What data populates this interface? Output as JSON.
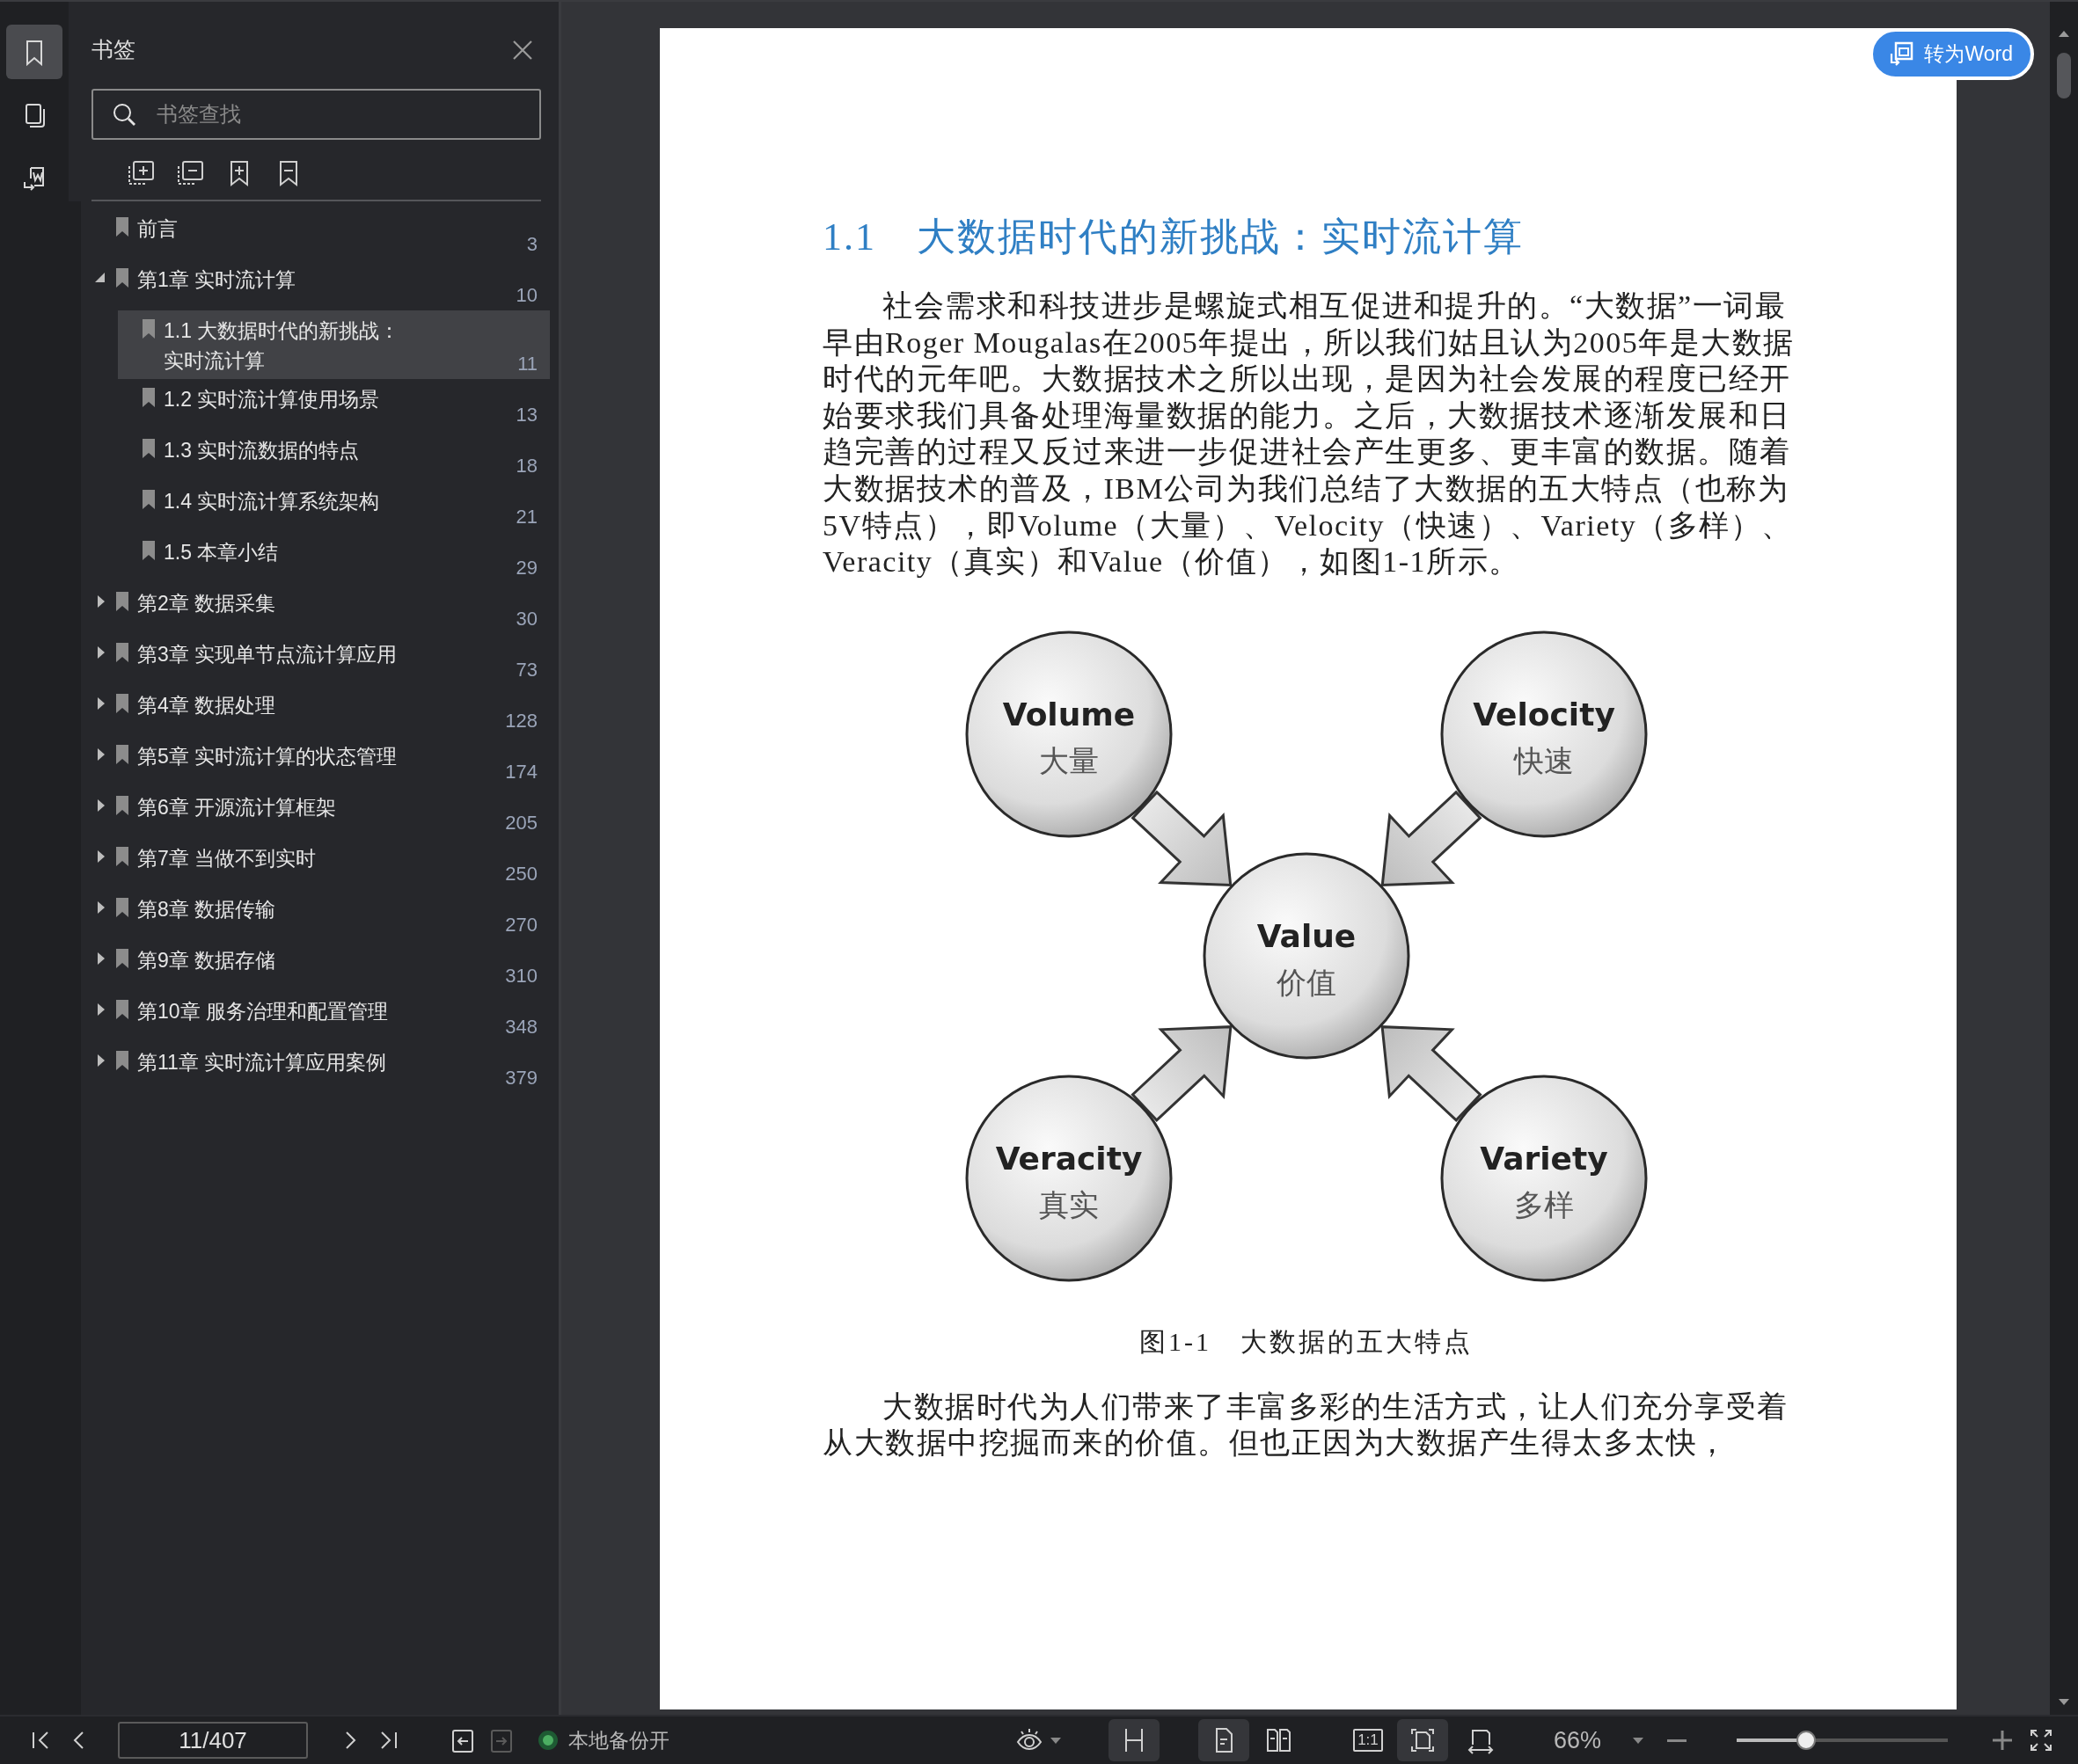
{
  "rail_tabs": [
    {
      "kind": "bookmarks",
      "selected": true
    },
    {
      "kind": "thumbnails",
      "selected": false
    },
    {
      "kind": "convert",
      "selected": false
    }
  ],
  "bookmark_panel": {
    "title": "书签",
    "search": {
      "placeholder": "书签查找"
    },
    "tree": [
      {
        "label": "前言",
        "page": "3",
        "selected": false
      },
      {
        "label": "第1章 实时流计算",
        "page": "10",
        "selected": false,
        "expanded": true,
        "children": [
          {
            "label": "1.1 大数据时代的新挑战：实时流计算",
            "page": "11",
            "selected": true
          },
          {
            "label": "1.2 实时流计算使用场景",
            "page": "13",
            "selected": false
          },
          {
            "label": "1.3 实时流数据的特点",
            "page": "18",
            "selected": false
          },
          {
            "label": "1.4 实时流计算系统架构",
            "page": "21",
            "selected": false
          },
          {
            "label": "1.5 本章小结",
            "page": "29",
            "selected": false
          }
        ]
      },
      {
        "label": "第2章 数据采集",
        "page": "30",
        "selected": false,
        "expanded": false
      },
      {
        "label": "第3章 实现单节点流计算应用",
        "page": "73",
        "selected": false,
        "expanded": false
      },
      {
        "label": "第4章 数据处理",
        "page": "128",
        "selected": false,
        "expanded": false
      },
      {
        "label": "第5章 实时流计算的状态管理",
        "page": "174",
        "selected": false,
        "expanded": false
      },
      {
        "label": "第6章 开源流计算框架",
        "page": "205",
        "selected": false,
        "expanded": false
      },
      {
        "label": "第7章 当做不到实时",
        "page": "250",
        "selected": false,
        "expanded": false
      },
      {
        "label": "第8章 数据传输",
        "page": "270",
        "selected": false,
        "expanded": false
      },
      {
        "label": "第9章 数据存储",
        "page": "310",
        "selected": false,
        "expanded": false
      },
      {
        "label": "第10章 服务治理和配置管理",
        "page": "348",
        "selected": false,
        "expanded": false
      },
      {
        "label": "第11章 实时流计算应用案例",
        "page": "379",
        "selected": false,
        "expanded": false
      }
    ]
  },
  "document": {
    "heading": "1.1　大数据时代的新挑战：实时流计算",
    "paragraphs": [
      "社会需求和科技进步是螺旋式相互促进和提升的。“大数据”一词最早由Roger Mougalas在2005年提出，所以我们姑且认为2005年是大数据时代的元年吧。大数据技术之所以出现，是因为社会发展的程度已经开始要求我们具备处理海量数据的能力。之后，大数据技术逐渐发展和日趋完善的过程又反过来进一步促进社会产生更多、更丰富的数据。随着大数据技术的普及，IBM公司为我们总结了大数据的五大特点（也称为5V特点），即Volume（大量）、Velocity（快速）、Variety（多样）、Veracity（真实）和Value（价值），如图1-1所示。",
      "大数据时代为人们带来了丰富多彩的生活方式，让人们充分享受着从大数据中挖掘而来的价值。但也正因为大数据产生得太多太快，"
    ],
    "figure": {
      "nodes": [
        {
          "title": "Volume",
          "subtitle": "大量"
        },
        {
          "title": "Velocity",
          "subtitle": "快速"
        },
        {
          "title": "Value",
          "subtitle": "价值"
        },
        {
          "title": "Veracity",
          "subtitle": "真实"
        },
        {
          "title": "Variety",
          "subtitle": "多样"
        }
      ],
      "caption": "图1-1　大数据的五大特点"
    }
  },
  "convert_button": {
    "label": "转为Word"
  },
  "toolbar": {
    "page_field": {
      "value": "11/407"
    },
    "forward_disabled": true,
    "backup": {
      "label": "本地备份开",
      "on": true
    },
    "view_buttons": [
      {
        "kind": "continuous",
        "selected": true
      },
      {
        "kind": "single-page",
        "selected": true
      },
      {
        "kind": "two-page",
        "selected": false
      },
      {
        "kind": "actual-size",
        "label": "1:1",
        "selected": false
      },
      {
        "kind": "fit-page",
        "selected": true
      },
      {
        "kind": "fit-width",
        "selected": false
      }
    ],
    "zoom": {
      "value": "66%"
    },
    "zoom_slider": {
      "level": 0.33
    }
  }
}
